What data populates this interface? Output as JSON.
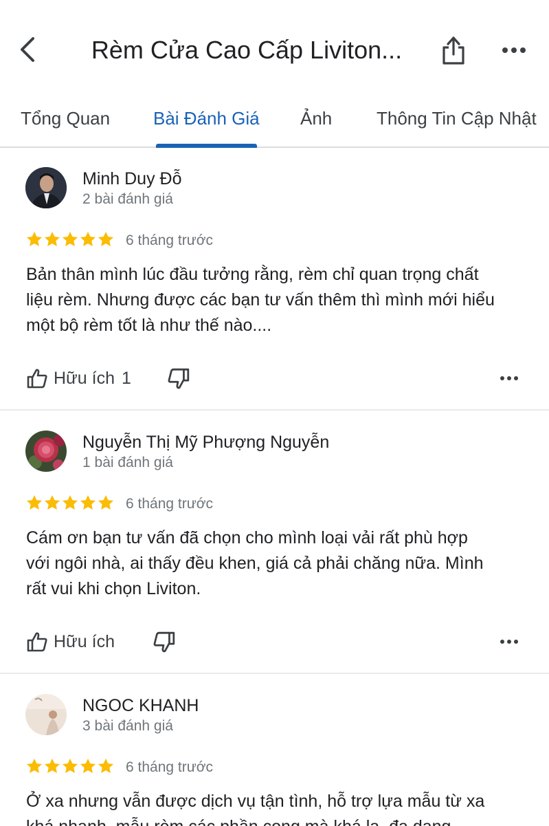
{
  "header": {
    "title": "Rèm Cửa Cao Cấp Liviton..."
  },
  "tabs": [
    {
      "label": "Tổng Quan",
      "active": false
    },
    {
      "label": "Bài Đánh Giá",
      "active": true
    },
    {
      "label": "Ảnh",
      "active": false
    },
    {
      "label": "Thông Tin Cập Nhật",
      "active": false
    }
  ],
  "colors": {
    "accent": "#1a62b6",
    "star": "#fbbc04"
  },
  "reviews": [
    {
      "name": "Minh Duy Đỗ",
      "review_count": "2 bài đánh giá",
      "rating": 5,
      "time": "6 tháng trước",
      "text_lines": [
        "Bản thân mình lúc đầu tưởng rằng, rèm chỉ quan trọng chất",
        "liệu rèm. Nhưng được các bạn tư vấn thêm thì mình mới hiểu",
        "một bộ rèm tốt là như thế nào...."
      ],
      "helpful_label": "Hữu ích",
      "helpful_count": "1"
    },
    {
      "name": "Nguyễn Thị Mỹ Phượng Nguyễn",
      "review_count": "1 bài đánh giá",
      "rating": 5,
      "time": "6 tháng trước",
      "text_lines": [
        "Cám ơn bạn tư vấn đã chọn cho mình loại vải rất phù hợp",
        "với ngôi nhà, ai thấy đều khen, giá cả phải chăng nữa. Mình",
        "rất vui khi chọn Liviton."
      ],
      "helpful_label": "Hữu ích",
      "helpful_count": ""
    },
    {
      "name": "NGOC KHANH",
      "review_count": "3 bài đánh giá",
      "rating": 5,
      "time": "6 tháng trước",
      "text_lines": [
        "Ở xa nhưng vẫn được dịch vụ tận tình, hỗ trợ lựa mẫu từ xa",
        "khá nhanh, mẫu rèm các phần cong mà khá lạ, đa dạng"
      ]
    }
  ]
}
